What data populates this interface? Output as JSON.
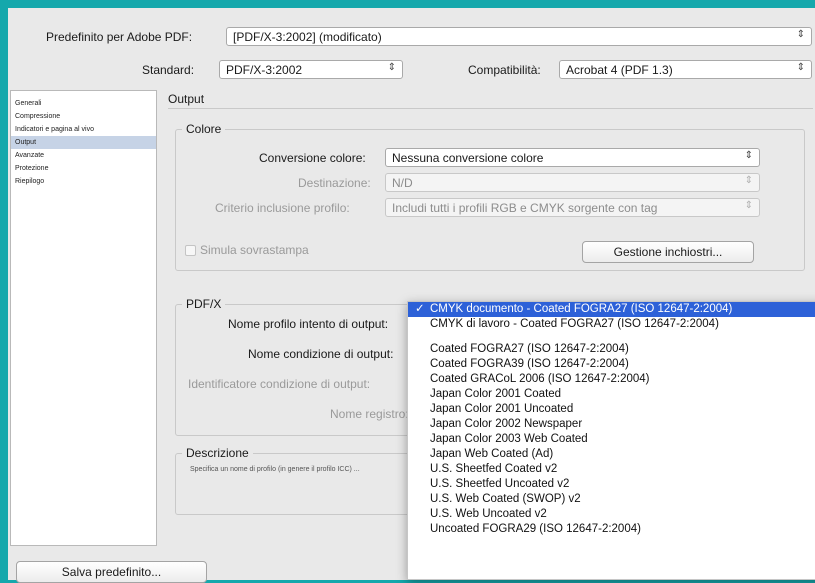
{
  "header": {
    "preset_label": "Predefinito per Adobe PDF:",
    "preset_value": "[PDF/X-3:2002] (modificato)",
    "standard_label": "Standard:",
    "standard_value": "PDF/X-3:2002",
    "compat_label": "Compatibilità:",
    "compat_value": "Acrobat 4 (PDF 1.3)"
  },
  "sidebar": {
    "items": [
      {
        "label": "Generali"
      },
      {
        "label": "Compressione"
      },
      {
        "label": "Indicatori e pagina al vivo"
      },
      {
        "label": "Output"
      },
      {
        "label": "Avanzate"
      },
      {
        "label": "Protezione"
      },
      {
        "label": "Riepilogo"
      }
    ],
    "active_index": 3
  },
  "main": {
    "section_title": "Output",
    "color_group": {
      "title": "Colore",
      "conversion_label": "Conversione colore:",
      "conversion_value": "Nessuna conversione colore",
      "destination_label": "Destinazione:",
      "destination_value": "N/D",
      "profile_label": "Criterio inclusione profilo:",
      "profile_value": "Includi tutti i profili RGB e CMYK sorgente con tag",
      "simulate_label": "Simula sovrastampa",
      "ink_button": "Gestione inchiostri..."
    },
    "pdfx_group": {
      "title": "PDF/X",
      "intent_label": "Nome profilo intento di output:",
      "condition_label": "Nome condizione di output:",
      "identifier_label": "Identificatore condizione di output:",
      "registry_label": "Nome registro:"
    },
    "description_group": {
      "title": "Descrizione",
      "text": "Specifica un nome di profilo (in genere il profilo ICC) ..."
    }
  },
  "footer": {
    "save_preset": "Salva predefinito..."
  },
  "dropdown": {
    "checkmark": "✓",
    "items": [
      {
        "label": "CMYK documento - Coated FOGRA27 (ISO 12647-2:2004)",
        "selected": true
      },
      {
        "label": "CMYK di lavoro - Coated FOGRA27 (ISO 12647-2:2004)"
      },
      {
        "separator": true
      },
      {
        "label": "Coated FOGRA27 (ISO 12647-2:2004)"
      },
      {
        "label": "Coated FOGRA39 (ISO 12647-2:2004)"
      },
      {
        "label": "Coated GRACoL 2006 (ISO 12647-2:2004)"
      },
      {
        "label": "Japan Color 2001 Coated"
      },
      {
        "label": "Japan Color 2001 Uncoated"
      },
      {
        "label": "Japan Color 2002 Newspaper"
      },
      {
        "label": "Japan Color 2003 Web Coated"
      },
      {
        "label": "Japan Web Coated (Ad)"
      },
      {
        "label": "U.S. Sheetfed Coated v2"
      },
      {
        "label": "U.S. Sheetfed Uncoated v2"
      },
      {
        "label": "U.S. Web Coated (SWOP) v2"
      },
      {
        "label": "U.S. Web Uncoated v2"
      },
      {
        "label": "Uncoated FOGRA29 (ISO 12647-2:2004)"
      }
    ]
  },
  "icons": {
    "select_arrow": "⇕"
  },
  "colors": {
    "background": "#15a8ac",
    "selection": "#2d61d8",
    "sidebar_active": "#c6d3e6"
  }
}
